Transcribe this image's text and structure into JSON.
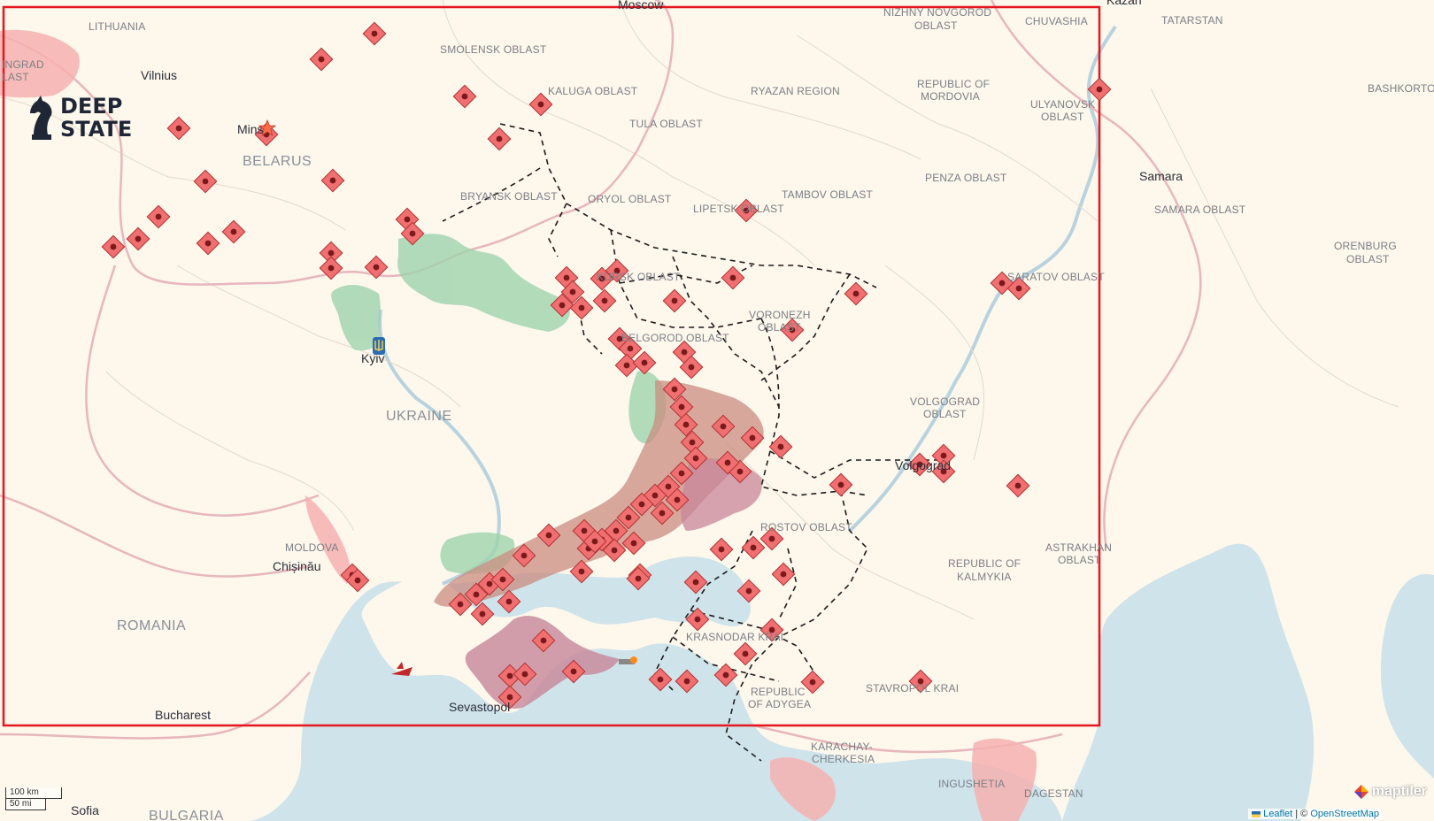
{
  "labels": {
    "countries": [
      {
        "name": "BELARUS"
      },
      {
        "name": "UKRAINE"
      },
      {
        "name": "ROMANIA"
      },
      {
        "name": "BULGARIA"
      },
      {
        "name": "MOLDOVA"
      },
      {
        "name": "LITHUANIA"
      }
    ],
    "regions": [
      {
        "text": "SMOLENSK OBLAST"
      },
      {
        "text": "KALUGA OBLAST"
      },
      {
        "text": "TULA OBLAST"
      },
      {
        "text": "RYAZAN REGION"
      },
      {
        "text": "NIZHNY NOVGOROD"
      },
      {
        "text": "OBLAST"
      },
      {
        "text": "CHUVASHIA"
      },
      {
        "text": "TATARSTAN"
      },
      {
        "text": "REPUBLIC OF"
      },
      {
        "text": "MORDOVIA"
      },
      {
        "text": "ULYANOVSK"
      },
      {
        "text": "OBLAST"
      },
      {
        "text": "BASHKORTOS"
      },
      {
        "text": "BRYANSK OBLAST"
      },
      {
        "text": "ORYOL OBLAST"
      },
      {
        "text": "LIPETSK OBLAST"
      },
      {
        "text": "TAMBOV OBLAST"
      },
      {
        "text": "PENZA OBLAST"
      },
      {
        "text": "SAMARA OBLAST"
      },
      {
        "text": "ORENBURG"
      },
      {
        "text": "OBLAST"
      },
      {
        "text": "KURSK OBLAST"
      },
      {
        "text": "SARATOV OBLAST"
      },
      {
        "text": "VORONEZH"
      },
      {
        "text": "OBLAST"
      },
      {
        "text": "BELGOROD OBLAST"
      },
      {
        "text": "VOLGOGRAD"
      },
      {
        "text": "OBLAST"
      },
      {
        "text": "ROSTOV OBLAST"
      },
      {
        "text": "REPUBLIC OF"
      },
      {
        "text": "KALMYKIA"
      },
      {
        "text": "ASTRAKHAN"
      },
      {
        "text": "OBLAST"
      },
      {
        "text": "KRASNODAR KRAI"
      },
      {
        "text": "REPUBLIC"
      },
      {
        "text": "OF ADYGEA"
      },
      {
        "text": "STAVROPOL KRAI"
      },
      {
        "text": "KARACHAY-"
      },
      {
        "text": "CHERKESIA"
      },
      {
        "text": "INGUSHETIA"
      },
      {
        "text": "DAGESTAN"
      },
      {
        "text": "INGRAD"
      },
      {
        "text": "LAST"
      }
    ],
    "cities": [
      {
        "name": "Vilnius"
      },
      {
        "name": "Minsk"
      },
      {
        "name": "Kyiv"
      },
      {
        "name": "Chișinău"
      },
      {
        "name": "Bucharest"
      },
      {
        "name": "Sofia"
      },
      {
        "name": "Sevastopol"
      },
      {
        "name": "Volgograd"
      },
      {
        "name": "Samara"
      },
      {
        "name": "Moscow"
      },
      {
        "name": "Kazan"
      }
    ]
  },
  "logo": {
    "line1": "DEEP",
    "line2": "STATE"
  },
  "scale": {
    "km": "100 km",
    "mi": "50 mi"
  },
  "attribution": {
    "leaflet": "Leaflet",
    "sep": "| ©",
    "osm": "OpenStreetMap"
  },
  "maptiler": "maptiler",
  "colors": {
    "land": "#fdf7ec",
    "sea": "#cfe3ea",
    "occupied": "#c98c80",
    "occupied_pink": "#c7869a",
    "liberated": "#9fd3ae",
    "marker": "#f06f71",
    "frame": "#e3171d",
    "route": "#1c1c1c"
  },
  "icons": {
    "marker": "airfield-diamond-icon",
    "logo": "knight-chess-icon",
    "star": "capital-star-icon",
    "ship": "sunk-ship-icon"
  }
}
